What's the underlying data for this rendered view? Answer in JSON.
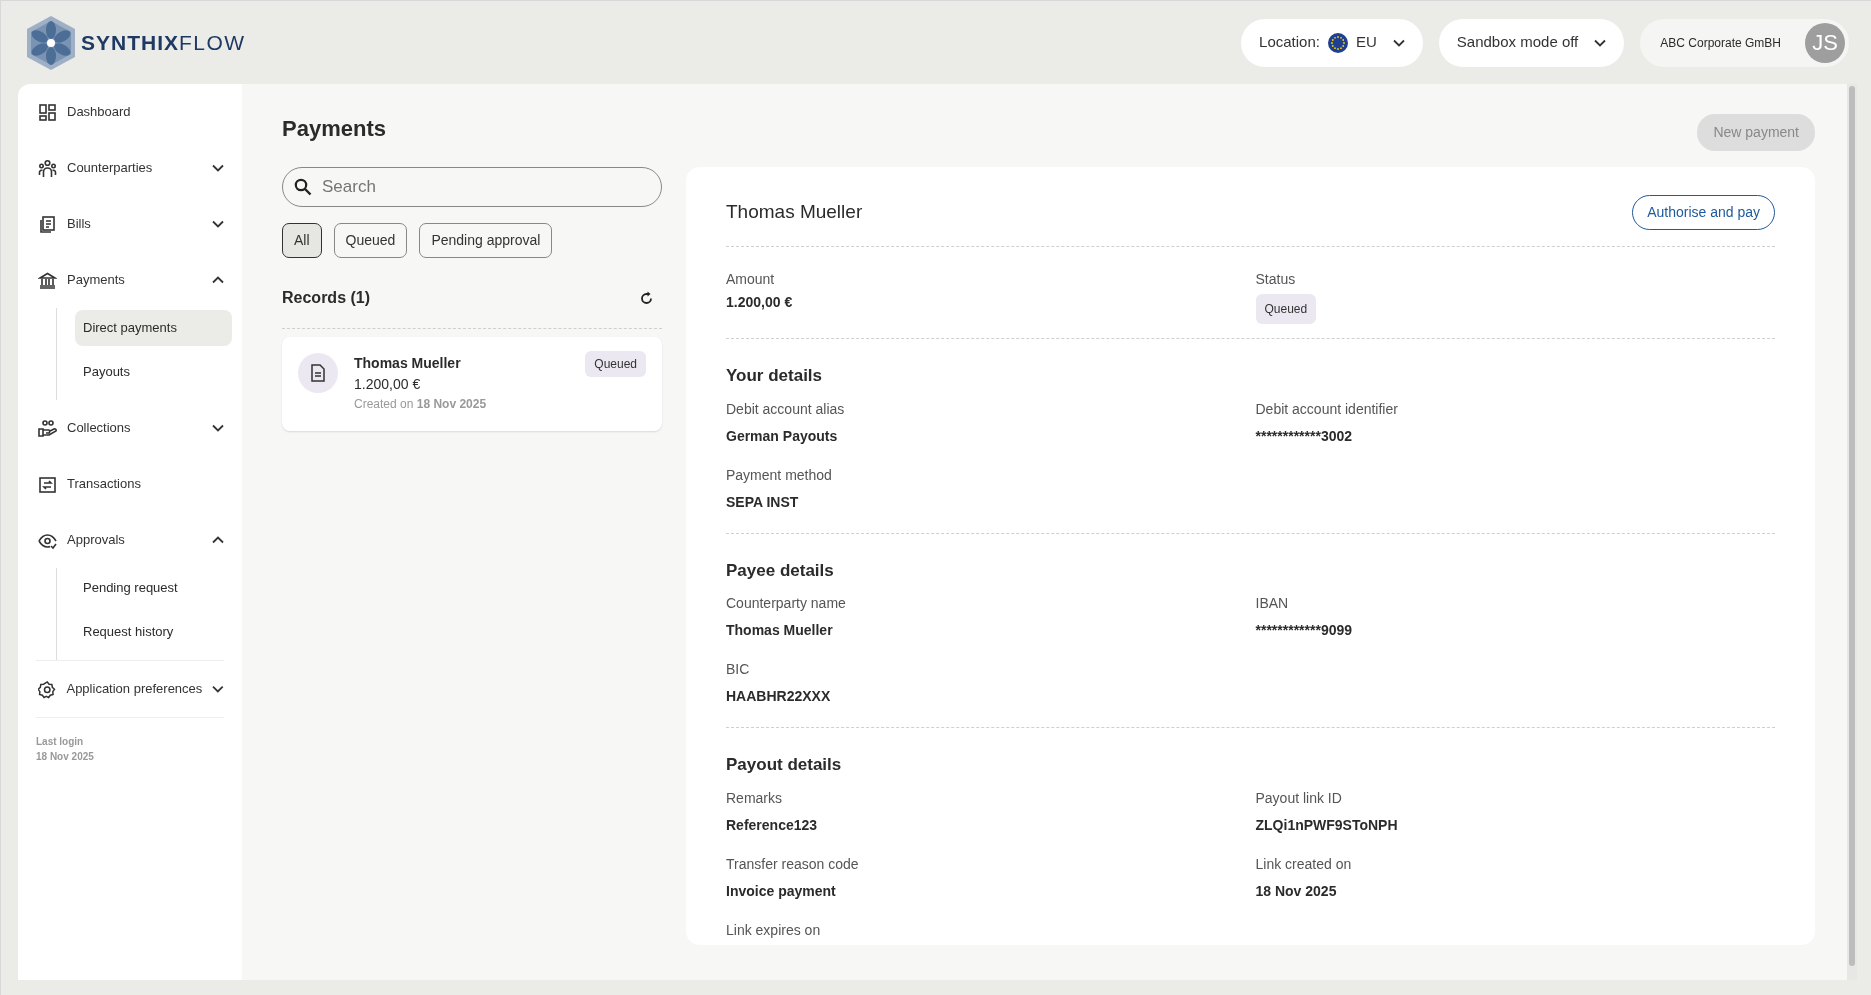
{
  "header": {
    "logo": {
      "brand_bold": "SYNTHIX",
      "brand_light": "FLOW"
    },
    "location": {
      "label": "Location:",
      "value": "EU"
    },
    "sandbox": {
      "label": "Sandbox mode off"
    },
    "account": {
      "company": "ABC Corporate GmBH",
      "initials": "JS"
    }
  },
  "sidebar": {
    "items": [
      {
        "kind": "link",
        "label": "Dashboard"
      },
      {
        "kind": "group",
        "label": "Counterparties",
        "expanded": false
      },
      {
        "kind": "group",
        "label": "Bills",
        "expanded": false
      },
      {
        "kind": "group",
        "label": "Payments",
        "expanded": true,
        "children": [
          {
            "label": "Direct payments",
            "selected": true
          },
          {
            "label": "Payouts",
            "selected": false
          }
        ]
      },
      {
        "kind": "group",
        "label": "Collections",
        "expanded": false
      },
      {
        "kind": "link",
        "label": "Transactions"
      },
      {
        "kind": "group",
        "label": "Approvals",
        "expanded": true,
        "children": [
          {
            "label": "Pending request",
            "selected": false
          },
          {
            "label": "Request history",
            "selected": false
          }
        ]
      },
      {
        "kind": "group",
        "label": "Application preferences",
        "expanded": false
      }
    ],
    "last_login": {
      "label": "Last login",
      "date": "18 Nov 2025"
    }
  },
  "page": {
    "title": "Payments",
    "new_button": {
      "label": "New payment",
      "disabled": true
    },
    "search": {
      "placeholder": "Search"
    },
    "filters": [
      {
        "label": "All",
        "selected": true
      },
      {
        "label": "Queued",
        "selected": false
      },
      {
        "label": "Pending approval",
        "selected": false
      }
    ],
    "records": {
      "title": "Records (1)",
      "items": [
        {
          "name": "Thomas Mueller",
          "amount": "1.200,00 €",
          "created_label": "Created on",
          "created_date": "18 Nov 2025",
          "status": "Queued"
        }
      ]
    }
  },
  "detail": {
    "name": "Thomas Mueller",
    "action": "Authorise and pay",
    "summary": [
      {
        "label": "Amount",
        "value": "1.200,00 €",
        "kind": "text"
      },
      {
        "label": "Status",
        "value": "Queued",
        "kind": "badge"
      }
    ],
    "sections": [
      {
        "title": "Your details",
        "fields": [
          {
            "label": "Debit account alias",
            "value": "German Payouts"
          },
          {
            "label": "Debit account identifier",
            "value": "************3002"
          },
          {
            "label": "Payment method",
            "value": "SEPA INST"
          }
        ]
      },
      {
        "title": "Payee details",
        "fields": [
          {
            "label": "Counterparty name",
            "value": "Thomas Mueller"
          },
          {
            "label": "IBAN",
            "value": "************9099"
          },
          {
            "label": "BIC",
            "value": "HAABHR22XXX"
          }
        ]
      },
      {
        "title": "Payout details",
        "fields": [
          {
            "label": "Remarks",
            "value": "Reference123"
          },
          {
            "label": "Payout link ID",
            "value": "ZLQi1nPWF9SToNPH"
          },
          {
            "label": "Transfer reason code",
            "value": "Invoice payment"
          },
          {
            "label": "Link created on",
            "value": "18 Nov 2025"
          },
          {
            "label": "Link expires on"
          }
        ]
      }
    ]
  }
}
